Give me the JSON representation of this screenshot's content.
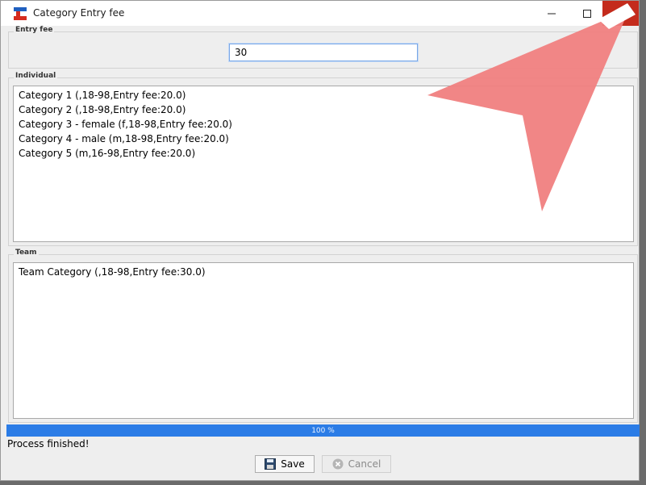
{
  "window": {
    "title": "Category Entry fee"
  },
  "entry_fee": {
    "label": "Entry fee",
    "value": "30"
  },
  "individual": {
    "label": "Individual",
    "items": [
      "Category 1 (,18-98,Entry fee:20.0)",
      "Category 2 (,18-98,Entry fee:20.0)",
      "Category 3 - female (f,18-98,Entry fee:20.0)",
      "Category 4 - male (m,18-98,Entry fee:20.0)",
      "Category 5 (m,16-98,Entry fee:20.0)"
    ]
  },
  "team": {
    "label": "Team",
    "items": [
      "Team Category (,18-98,Entry fee:30.0)"
    ]
  },
  "progress": {
    "value": 100,
    "text": "100 %"
  },
  "status": "Process finished!",
  "buttons": {
    "save": "Save",
    "cancel": "Cancel"
  },
  "colors": {
    "close_hover": "#c42b1c",
    "progress": "#2b7ce6",
    "arrow": "#f08080"
  }
}
